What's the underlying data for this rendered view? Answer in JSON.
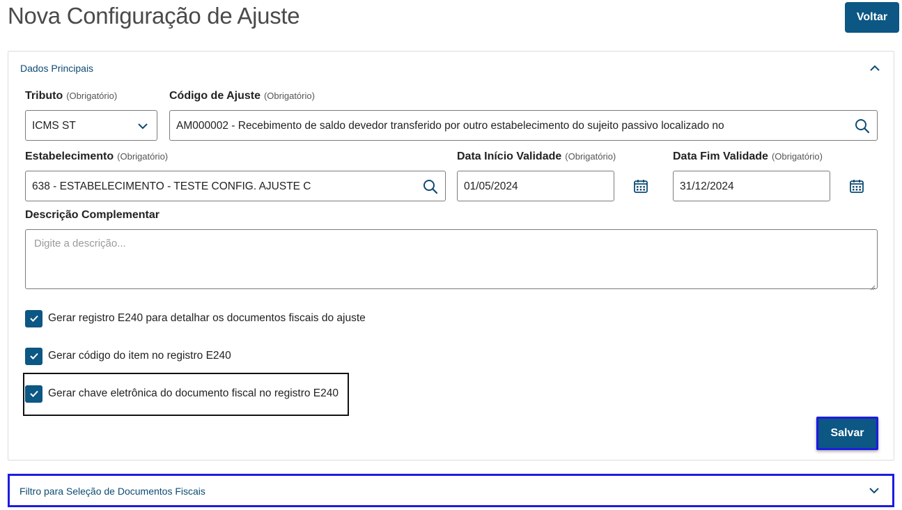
{
  "header": {
    "title": "Nova Configuração de Ajuste",
    "back_label": "Voltar"
  },
  "section_main": {
    "title": "Dados Principais",
    "expanded": true,
    "optional_tag": "(Obrigatório)",
    "tributo": {
      "label": "Tributo",
      "value": "ICMS ST"
    },
    "codigo_ajuste": {
      "label": "Código de Ajuste",
      "value": "AM000002 - Recebimento de saldo devedor transferido por outro estabelecimento do sujeito passivo localizado no"
    },
    "estabelecimento": {
      "label": "Estabelecimento",
      "value": "638 - ESTABELECIMENTO - TESTE CONFIG. AJUSTE C"
    },
    "data_inicio": {
      "label": "Data Início Validade",
      "value": "01/05/2024"
    },
    "data_fim": {
      "label": "Data Fim Validade",
      "value": "31/12/2024"
    },
    "descricao": {
      "label": "Descrição Complementar",
      "placeholder": "Digite a descrição..."
    },
    "checkboxes": [
      {
        "label": "Gerar registro E240 para detalhar os documentos fiscais do ajuste",
        "checked": true
      },
      {
        "label": "Gerar código do item no registro E240",
        "checked": true
      },
      {
        "label": "Gerar chave eletrônica do documento fiscal no registro E240",
        "checked": true
      }
    ],
    "save_label": "Salvar"
  },
  "section_filter": {
    "title": "Filtro para Seleção de Documentos Fiscais",
    "expanded": false
  },
  "colors": {
    "primary": "#0c5783",
    "focus_outline": "#1c1ce0",
    "section_title": "#0c4a73"
  },
  "icons": [
    "chevron-up-icon",
    "chevron-down-icon",
    "search-icon",
    "calendar-icon",
    "check-icon"
  ]
}
